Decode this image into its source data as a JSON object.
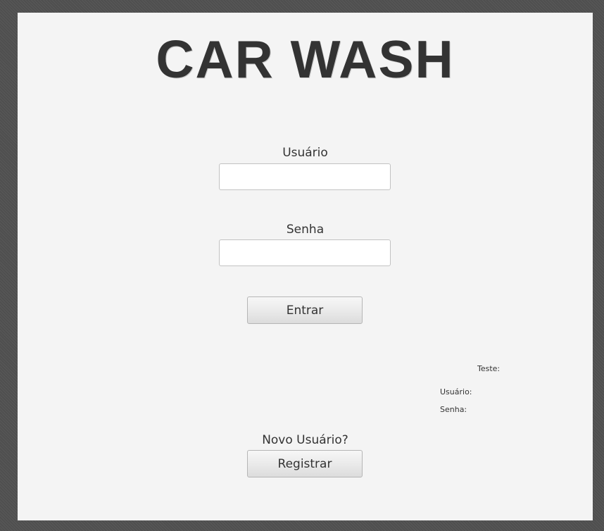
{
  "header": {
    "title": "CAR WASH"
  },
  "login": {
    "username_label": "Usuário",
    "username_value": "",
    "password_label": "Senha",
    "password_value": "",
    "submit_label": "Entrar"
  },
  "debug": {
    "title": "Teste:",
    "username_label": "Usuário:",
    "password_label": "Senha:"
  },
  "register": {
    "prompt": "Novo Usuário?",
    "button_label": "Registrar"
  }
}
